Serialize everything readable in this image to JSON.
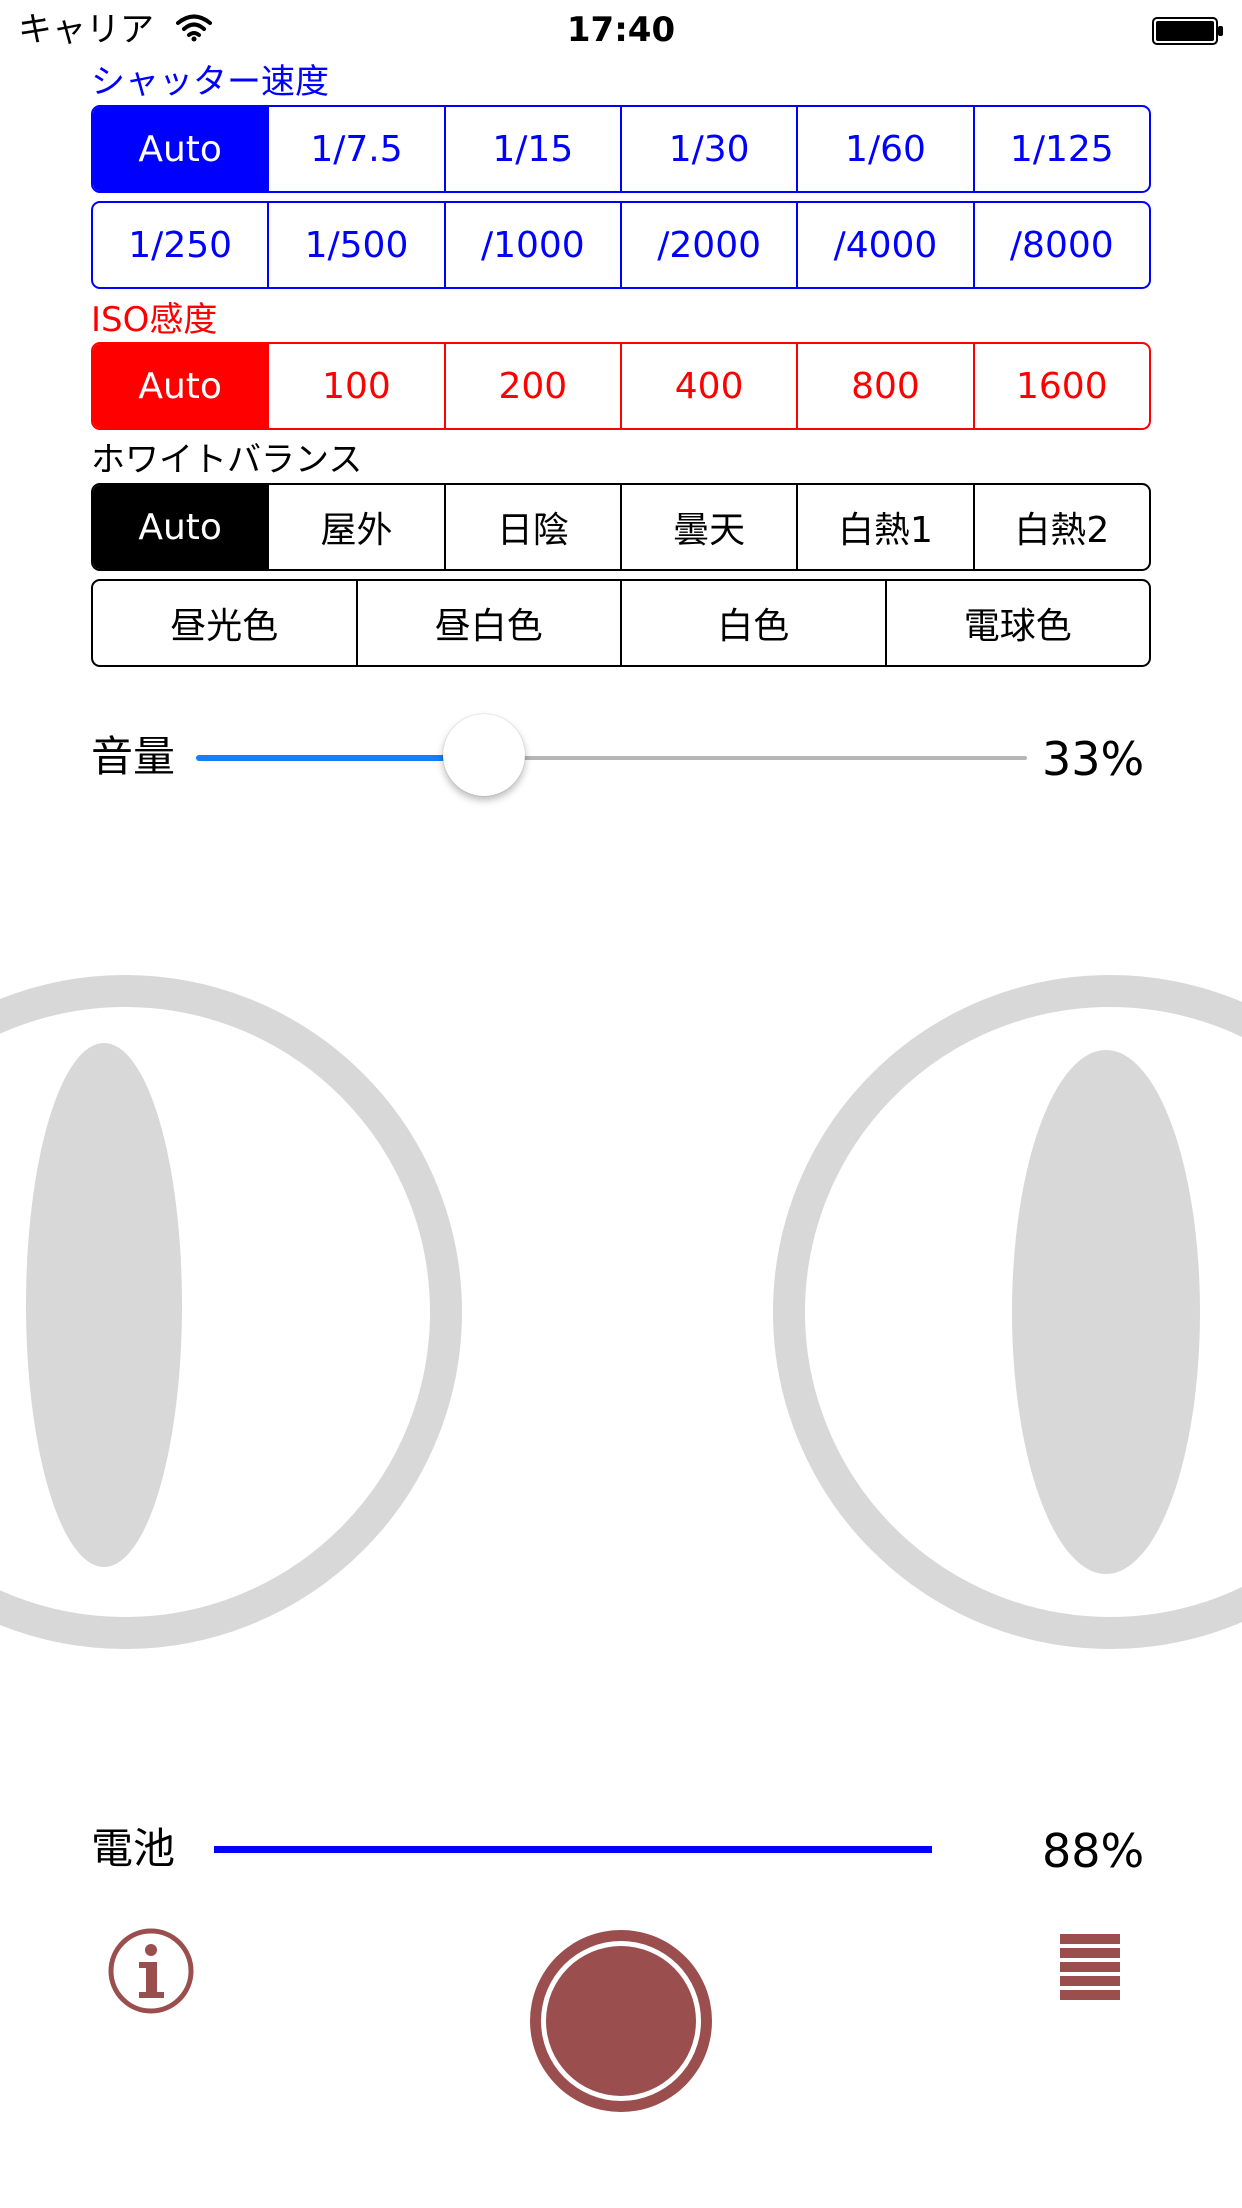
{
  "status_bar": {
    "carrier": "キャリア",
    "time": "17:40"
  },
  "shutter": {
    "label": "シャッター速度",
    "row1": [
      "Auto",
      "1/7.5",
      "1/15",
      "1/30",
      "1/60",
      "1/125"
    ],
    "row2": [
      "1/250",
      "1/500",
      "/1000",
      "/2000",
      "/4000",
      "/8000"
    ],
    "selected": "Auto"
  },
  "iso": {
    "label": "ISO感度",
    "options": [
      "Auto",
      "100",
      "200",
      "400",
      "800",
      "1600"
    ],
    "selected": "Auto"
  },
  "white_balance": {
    "label": "ホワイトバランス",
    "row1": [
      "Auto",
      "屋外",
      "日陰",
      "曇天",
      "白熱1",
      "白熱2"
    ],
    "row2": [
      "昼光色",
      "昼白色",
      "白色",
      "電球色"
    ],
    "selected": "Auto"
  },
  "volume": {
    "label": "音量",
    "value_text": "33%",
    "level": 0.33
  },
  "battery": {
    "label": "電池",
    "value_text": "88%",
    "level": 0.88
  },
  "toolbar": {
    "info_icon": "info-icon",
    "shutter_icon": "record-shutter-icon",
    "menu_icon": "menu-list-icon"
  },
  "colors": {
    "shutter_accent": "#0000ff",
    "iso_accent": "#ff0000",
    "wb_accent": "#000000",
    "slider_fill": "#147efb",
    "battery_bar": "#0000ff",
    "toolbar_icon": "#9b4e4e",
    "eye_gray": "#d8d8d8"
  }
}
